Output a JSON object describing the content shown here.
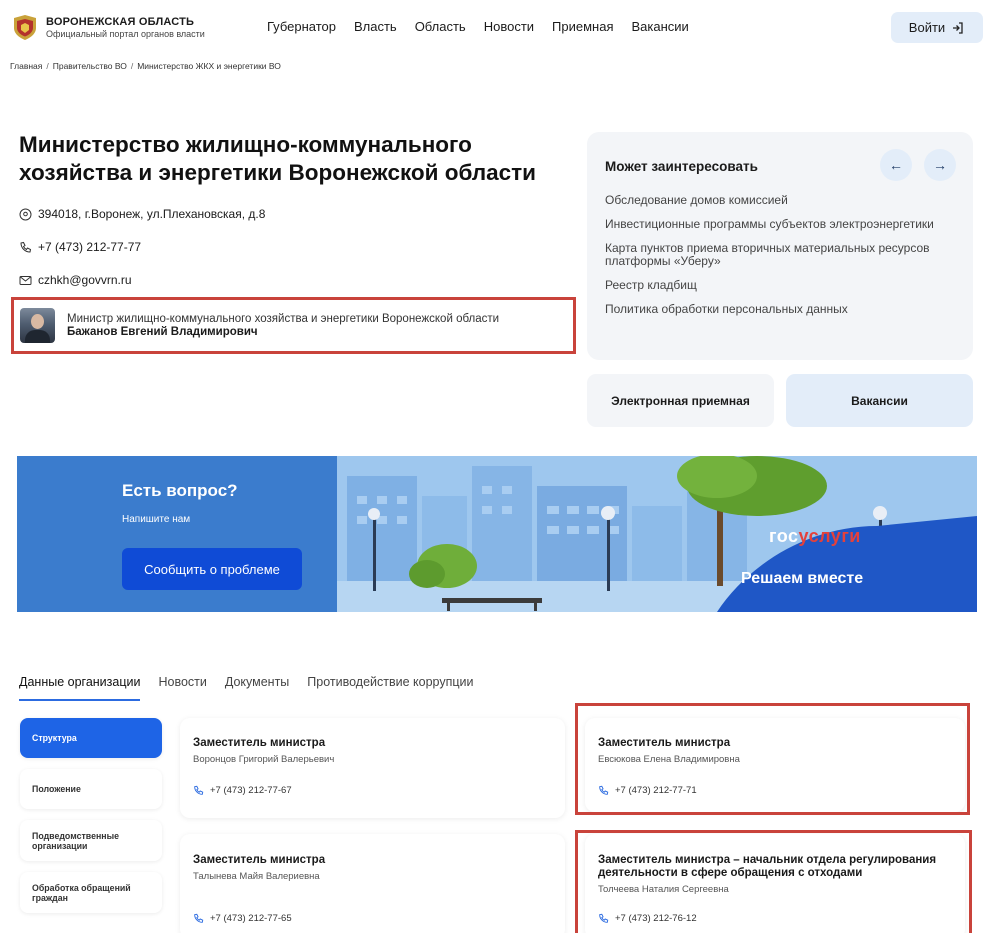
{
  "header": {
    "brand_title": "ВОРОНЕЖСКАЯ ОБЛАСТЬ",
    "brand_subtitle": "Официальный портал органов власти",
    "nav": [
      "Губернатор",
      "Власть",
      "Область",
      "Новости",
      "Приемная",
      "Вакансии"
    ],
    "login_label": "Войти"
  },
  "breadcrumb": [
    "Главная",
    "Правительство ВО",
    "Министерство ЖКХ и энергетики ВО"
  ],
  "ministry": {
    "title": "Министерство жилищно-коммунального хозяйства и энергетики Воронежской области",
    "address": "394018, г.Воронеж, ул.Плехановская, д.8",
    "phone": "+7 (473) 212-77-77",
    "email": "czhkh@govvrn.ru",
    "minister_role": "Министр жилищно-коммунального хозяйства и энергетики Воронежской области",
    "minister_name": "Бажанов Евгений Владимирович"
  },
  "interest": {
    "title": "Может заинтересовать",
    "links": [
      "Обследование домов комиссией",
      "Инвестиционные программы субъектов электроэнергетики",
      "Карта пунктов приема вторичных материальных ресурсов платформы «Уберу»",
      "Реестр кладбищ",
      "Политика обработки персональных данных"
    ],
    "prev_icon": "←",
    "next_icon": "→"
  },
  "buttons": {
    "reception": "Электронная приемная",
    "vacancies": "Вакансии"
  },
  "banner": {
    "question": "Есть вопрос?",
    "subtitle": "Напишите нам",
    "button": "Сообщить о проблеме",
    "gos_part1": "гос",
    "gos_part2": "услуги",
    "gos_sub": "Решаем вместе"
  },
  "tabs": [
    "Данные организации",
    "Новости",
    "Документы",
    "Противодействие коррупции"
  ],
  "side_menu": [
    "Структура",
    "Положение",
    "Подведомственные организации",
    "Обработка обращений граждан"
  ],
  "cards": [
    {
      "title": "Заместитель министра",
      "name": "Воронцов Григорий Валерьевич",
      "phone": "+7 (473) 212-77-67"
    },
    {
      "title": "Заместитель министра",
      "name": "Евсюкова Елена Владимировна",
      "phone": "+7 (473) 212-77-71"
    },
    {
      "title": "Заместитель министра",
      "name": "Талынева Майя Валериевна",
      "phone": "+7 (473) 212-77-65"
    },
    {
      "title": "Заместитель министра – начальник отдела регулирования деятельности в сфере обращения с отходами",
      "name": "Толчеева Наталия Сергеевна",
      "phone": "+7 (473) 212-76-12"
    }
  ],
  "colors": {
    "accent": "#1e64e6",
    "light_blue": "#e3edf9",
    "highlight_red": "#c9433b",
    "banner_blue": "#3d7fd0"
  }
}
